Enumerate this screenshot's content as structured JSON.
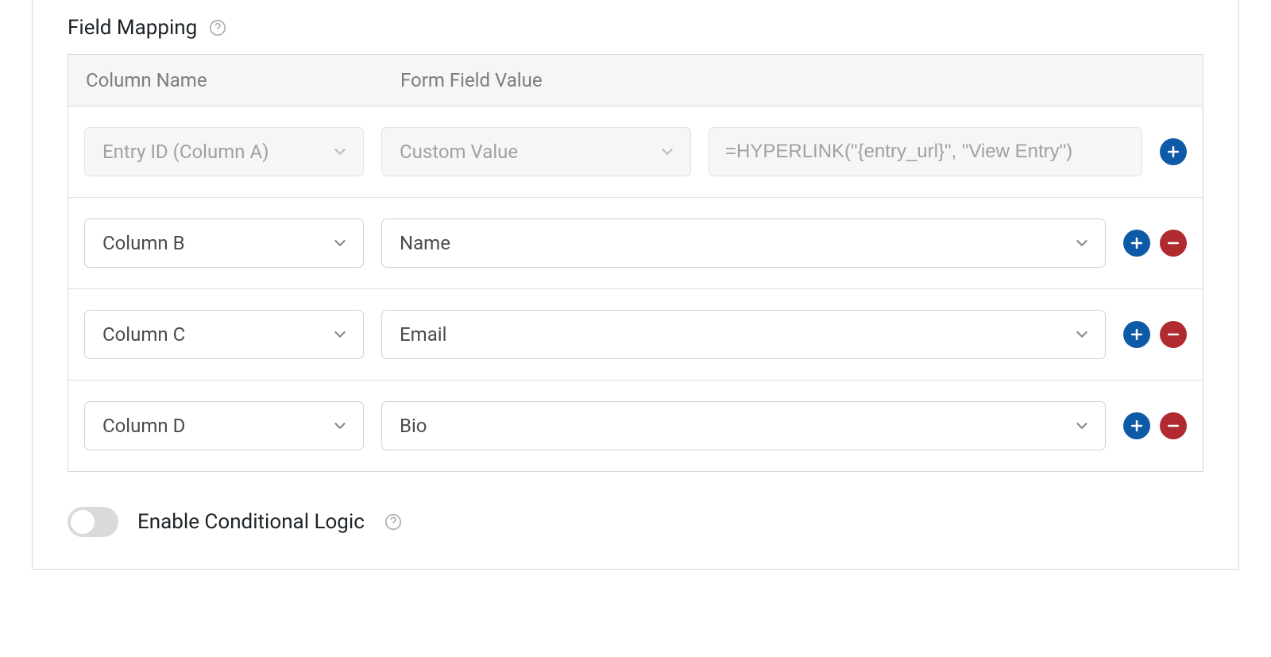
{
  "section": {
    "title": "Field Mapping",
    "headers": {
      "column_name": "Column Name",
      "form_field_value": "Form Field Value"
    }
  },
  "rows": [
    {
      "column": "Entry ID (Column A)",
      "field": "Custom Value",
      "custom": "=HYPERLINK(\"{entry_url}\", \"View Entry\")",
      "disabled": true,
      "removable": false
    },
    {
      "column": "Column B",
      "field": "Name",
      "custom": null,
      "disabled": false,
      "removable": true
    },
    {
      "column": "Column C",
      "field": "Email",
      "custom": null,
      "disabled": false,
      "removable": true
    },
    {
      "column": "Column D",
      "field": "Bio",
      "custom": null,
      "disabled": false,
      "removable": true
    }
  ],
  "conditional": {
    "label": "Enable Conditional Logic",
    "enabled": false
  }
}
